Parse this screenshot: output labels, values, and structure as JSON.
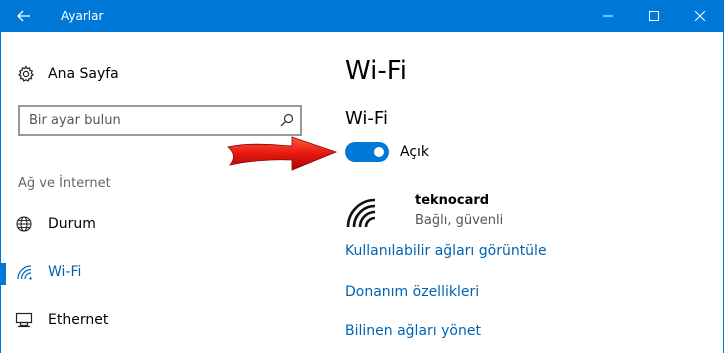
{
  "window": {
    "title": "Ayarlar",
    "back_icon": "arrow-left-icon",
    "controls": [
      "minimize-icon",
      "maximize-icon",
      "close-icon"
    ],
    "accent_color": "#0078d7"
  },
  "sidebar": {
    "home_label": "Ana Sayfa",
    "home_icon": "gear-icon",
    "search_placeholder": "Bir ayar bulun",
    "search_icon": "search-icon",
    "section_label": "Ağ ve İnternet",
    "items": [
      {
        "label": "Durum",
        "icon": "globe-icon",
        "selected": false
      },
      {
        "label": "Wi-Fi",
        "icon": "wifi-icon",
        "selected": true
      },
      {
        "label": "Ethernet",
        "icon": "ethernet-icon",
        "selected": false
      }
    ]
  },
  "main": {
    "page_title": "Wi-Fi",
    "wifi_section_title": "Wi-Fi",
    "toggle_state_label": "Açık",
    "toggle_on": true,
    "connected_network": {
      "name": "teknocard",
      "status": "Bağlı, güvenli",
      "icon": "wifi-signal-icon"
    },
    "links": [
      "Kullanılabilir ağları görüntüle",
      "Donanım özellikleri",
      "Bilinen ağları yönet"
    ],
    "link_color": "#0063b1"
  },
  "annotation": {
    "icon": "red-arrow-icon",
    "color": "#e8170f"
  }
}
